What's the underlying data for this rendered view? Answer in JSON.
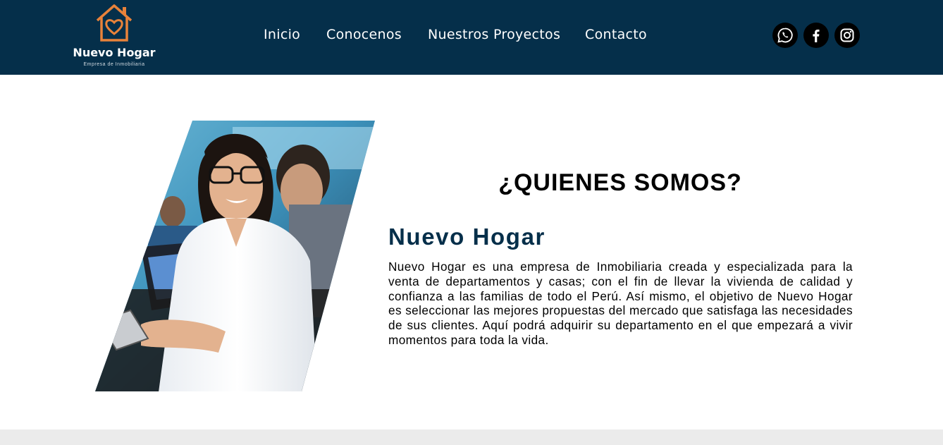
{
  "brand": {
    "name": "Nuevo Hogar",
    "tagline": "Empresa de Inmobiliaria",
    "logo_color": "#e8823a"
  },
  "nav": {
    "items": [
      "Inicio",
      "Conocenos",
      "Nuestros Proyectos",
      "Contacto"
    ]
  },
  "social": {
    "icons": [
      "whatsapp-icon",
      "facebook-icon",
      "instagram-icon"
    ]
  },
  "about": {
    "heading": "¿QUIENES SOMOS?",
    "subheading": "Nuevo Hogar",
    "paragraph": "Nuevo Hogar es una empresa de Inmobiliaria creada y especializada para la venta de departamentos y casas; con el fin de llevar la vivienda de calidad y confianza a las familias de todo el Perú. Así mismo, el objetivo de Nuevo Hogar es seleccionar las mejores propuestas del mercado que satisfaga las necesidades de sus clientes. Aquí podrá adquirir su departamento en el que empezará a vivir momentos para toda la vida."
  },
  "colors": {
    "header_bg": "#052f4a",
    "accent": "#e8823a",
    "footer_band": "#ebebeb"
  }
}
